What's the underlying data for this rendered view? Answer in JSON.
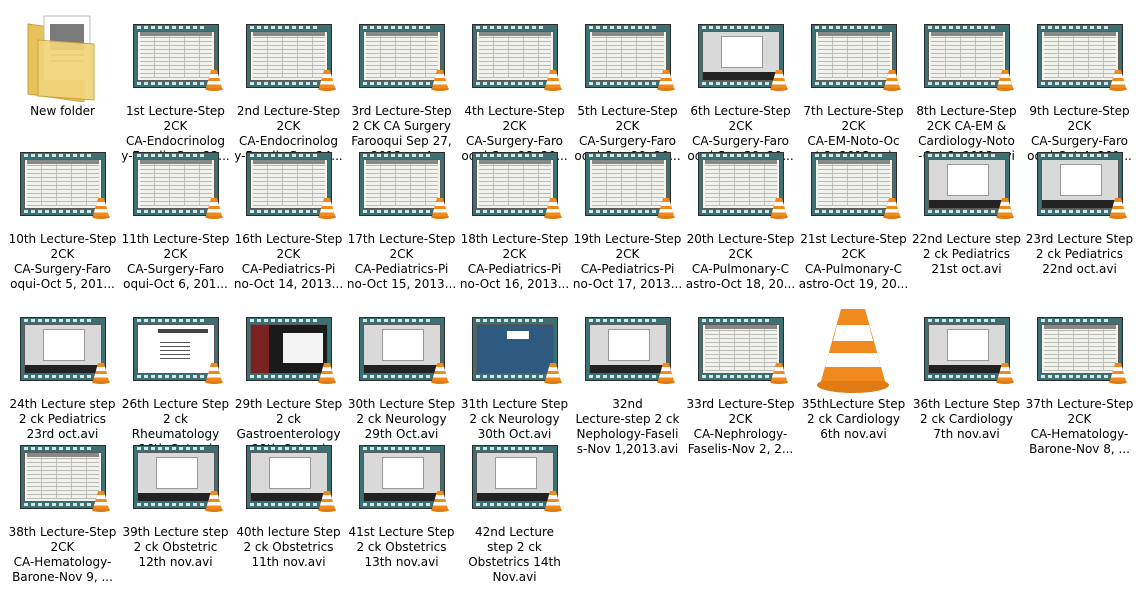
{
  "folder": {
    "label": "New folder"
  },
  "files": [
    {
      "label": "1st Lecture-Step\n2CK\nCA-Endocrinolog\ny-Faselis-Sep 23...",
      "thumb": "table"
    },
    {
      "label": "2nd Lecture-Step\n2CK\nCA-Endocrinolog\ny-Faselis-Sep 24...",
      "thumb": "table"
    },
    {
      "label": "3rd Lecture-Step\n2 CK CA Surgery\nFarooqui Sep 27,\n2013.mp4",
      "thumb": "table"
    },
    {
      "label": "4th Lecture-Step\n2CK\nCA-Surgery-Faro\noqui-Sep 28, 20...",
      "thumb": "table"
    },
    {
      "label": "5th Lecture-Step\n2CK\nCA-Surgery-Faro\noqui-Sep 29, 20...",
      "thumb": "table"
    },
    {
      "label": "6th Lecture-Step\n2CK\nCA-Surgery-Faro\noqui-Sep 30, 20...",
      "thumb": "dialog"
    },
    {
      "label": "7th Lecture-Step\n2CK\nCA-EM-Noto-Oc\nt 2, 2013.avi",
      "thumb": "table"
    },
    {
      "label": "8th Lecture-Step\n2CK CA-EM &\nCardiology-Noto\n-Oct 3, 2013.avi",
      "thumb": "table"
    },
    {
      "label": "9th Lecture-Step\n2CK\nCA-Surgery-Faro\noqui-Oct 4, 201...",
      "thumb": "table"
    },
    {
      "label": "10th Lecture-Step\n2CK\nCA-Surgery-Faro\noqui-Oct 5, 201...",
      "thumb": "table"
    },
    {
      "label": "11th Lecture-Step\n2CK\nCA-Surgery-Faro\noqui-Oct 6, 201...",
      "thumb": "table"
    },
    {
      "label": "16th Lecture-Step\n2CK\nCA-Pediatrics-Pi\nno-Oct 14, 2013...",
      "thumb": "table"
    },
    {
      "label": "17th Lecture-Step\n2CK\nCA-Pediatrics-Pi\nno-Oct 15, 2013...",
      "thumb": "table"
    },
    {
      "label": "18th Lecture-Step\n2CK\nCA-Pediatrics-Pi\nno-Oct 16, 2013...",
      "thumb": "table"
    },
    {
      "label": "19th Lecture-Step\n2CK\nCA-Pediatrics-Pi\nno-Oct 17, 2013...",
      "thumb": "table"
    },
    {
      "label": "20th Lecture-Step\n2CK\nCA-Pulmonary-C\nastro-Oct 18, 20...",
      "thumb": "table"
    },
    {
      "label": "21st Lecture-Step\n2CK\nCA-Pulmonary-C\nastro-Oct 19, 20...",
      "thumb": "table"
    },
    {
      "label": "22nd Lecture step\n2 ck Pediatrics\n21st oct.avi",
      "thumb": "dialog"
    },
    {
      "label": "23rd Lecture Step\n2 ck Pediatrics\n22nd oct.avi",
      "thumb": "dialog"
    },
    {
      "label": "24th Lecture step\n2 ck Pediatrics\n23rd oct.avi",
      "thumb": "dialog"
    },
    {
      "label": "26th Lecture Step\n2 ck\nRheumatology\n26th Oct.avi",
      "thumb": "slide"
    },
    {
      "label": "29th Lecture Step\n2 ck\nGastroenterology\n28th Oct.avi",
      "thumb": "dark"
    },
    {
      "label": "30th Lecture Step\n2 ck Neurology\n29th Oct.avi",
      "thumb": "dialog"
    },
    {
      "label": "31th Lecture Step\n2 ck Neurology\n30th Oct.avi",
      "thumb": "kaplan"
    },
    {
      "label": "32nd\nLecture-step 2 ck\nNephology-Faseli\ns-Nov 1,2013.avi",
      "thumb": "dialog"
    },
    {
      "label": "33rd Lecture-Step\n2CK\nCA-Nephrology-\nFaselis-Nov 2, 2...",
      "thumb": "table"
    },
    {
      "label": "35thLecture Step\n2 ck Cardiology\n6th nov.avi",
      "thumb": "cone"
    },
    {
      "label": "36th Lecture Step\n2 ck Cardiology\n7th nov.avi",
      "thumb": "dialog"
    },
    {
      "label": "37th Lecture-Step\n2CK\nCA-Hematology-\nBarone-Nov 8, ...",
      "thumb": "table"
    },
    {
      "label": "38th Lecture-Step\n2CK\nCA-Hematology-\nBarone-Nov 9, ...",
      "thumb": "table"
    },
    {
      "label": "39th Lecture step\n2 ck Obstetric\n12th nov.avi",
      "thumb": "dialog"
    },
    {
      "label": "40th lecture Step\n2 ck Obstetrics\n11th nov.avi",
      "thumb": "dialog"
    },
    {
      "label": "41st Lecture Step\n2 ck Obstetrics\n13th nov.avi",
      "thumb": "dialog"
    },
    {
      "label": "42nd  Lecture\nstep 2 ck\nObstetrics 14th\nNov.avi",
      "thumb": "dialog"
    }
  ]
}
